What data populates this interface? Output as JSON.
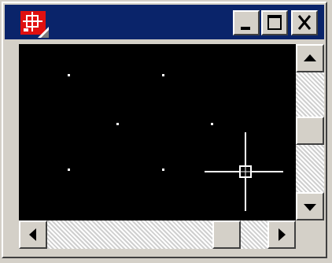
{
  "window": {
    "app_icon": "drawing-app-icon",
    "controls": {
      "minimize_icon": "minimize-icon",
      "maximize_icon": "maximize-icon",
      "close_icon": "close-icon"
    }
  },
  "canvas": {
    "background": "#000000",
    "grid_color": "#ffffff",
    "cursor": "crosshair-cursor-icon"
  },
  "scrollbars": {
    "vertical": {
      "up_icon": "arrow-up-icon",
      "down_icon": "arrow-down-icon"
    },
    "horizontal": {
      "left_icon": "arrow-left-icon",
      "right_icon": "arrow-right-icon"
    }
  },
  "colors": {
    "title_bar": "#0a246a",
    "app_icon_red": "#e01010",
    "face": "#d4d0c8"
  }
}
